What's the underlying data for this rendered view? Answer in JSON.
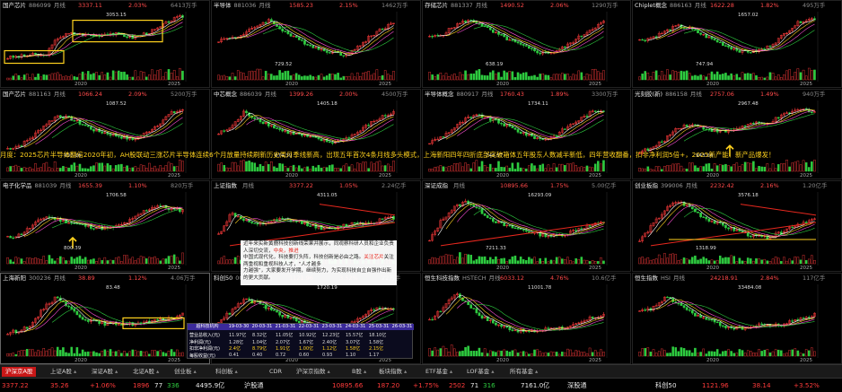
{
  "panels": [
    {
      "name": "国产芯片",
      "code": "886099",
      "period": "月线",
      "price": "3337.11",
      "change": "2.03%",
      "volume": "6413万手",
      "year1": "2020",
      "year2": "2025",
      "high": "3053.15",
      "low": "",
      "mark": ""
    },
    {
      "name": "半导体",
      "code": "881036",
      "period": "月线",
      "price": "1585.23",
      "change": "2.15%",
      "volume": "1462万手",
      "year1": "2020",
      "year2": "2025",
      "high": "",
      "low": "729.52",
      "mark": ""
    },
    {
      "name": "存储芯片",
      "code": "881337",
      "period": "月线",
      "price": "1490.52",
      "change": "2.06%",
      "volume": "1290万手",
      "year1": "2020",
      "year2": "2025",
      "high": "",
      "low": "638.19",
      "mark": ""
    },
    {
      "name": "Chiplet概念",
      "code": "886163",
      "period": "月线",
      "price": "1622.28",
      "change": "1.82%",
      "volume": "495万手",
      "year1": "2020",
      "year2": "2025",
      "high": "1657.02",
      "low": "747.94",
      "mark": ""
    },
    {
      "name": "国产芯片",
      "code": "881163",
      "period": "月线",
      "price": "1066.24",
      "change": "2.09%",
      "volume": "5200万手",
      "year1": "2020",
      "year2": "2025",
      "high": "1087.52",
      "low": "407.16",
      "mark": ""
    },
    {
      "name": "中芯概念",
      "code": "886039",
      "period": "月线",
      "price": "1399.26",
      "change": "2.00%",
      "volume": "4500万手",
      "year1": "2020",
      "year2": "2025",
      "high": "1405.18",
      "low": "674.39",
      "mark": ""
    },
    {
      "name": "半导体概念",
      "code": "880917",
      "period": "月线",
      "price": "1760.43",
      "change": "1.89%",
      "volume": "3300万手",
      "year1": "2020",
      "year2": "2025",
      "high": "1734.11",
      "low": "746.57",
      "mark": ""
    },
    {
      "name": "光刻胶(新)",
      "code": "886158",
      "period": "月线",
      "price": "2757.06",
      "change": "1.49%",
      "volume": "940万手",
      "year1": "2020",
      "year2": "2025",
      "high": "2967.48",
      "low": "943.64",
      "mark": ""
    },
    {
      "name": "电子化学品",
      "code": "881039",
      "period": "月线",
      "price": "1655.39",
      "change": "1.10%",
      "volume": "820万手",
      "year1": "2020",
      "year2": "2025",
      "high": "1706.58",
      "low": "800.39",
      "mark": ""
    },
    {
      "name": "上证指数",
      "code": "",
      "period": "月线",
      "price": "3377.22",
      "change": "1.05%",
      "volume": "2.24亿手",
      "year1": "2020",
      "year2": "2025",
      "high": "4311.05",
      "low": "2635.09",
      "mark": ""
    },
    {
      "name": "深证成指",
      "code": "",
      "period": "月线",
      "price": "10895.66",
      "change": "1.75%",
      "volume": "5.00亿手",
      "year1": "2020",
      "year2": "2025",
      "high": "16293.09",
      "low": "7211.33",
      "mark": ""
    },
    {
      "name": "创业板指",
      "code": "399006",
      "period": "月线",
      "price": "2232.42",
      "change": "2.16%",
      "volume": "1.20亿手",
      "year1": "2020",
      "year2": "2025",
      "high": "3576.18",
      "low": "1318.99",
      "mark": ""
    },
    {
      "name": "上海新阳",
      "code": "300236",
      "period": "月线",
      "price": "38.89",
      "change": "1.12%",
      "volume": "4.06万手",
      "year1": "2020",
      "year2": "2025",
      "high": "83.48",
      "low": "",
      "mark": ""
    },
    {
      "name": "科创50",
      "code": "000688",
      "period": "月线",
      "price": "1121.96",
      "change": "3.52%",
      "volume": "22万手",
      "year1": "2020",
      "year2": "2025",
      "high": "1720.19",
      "low": "",
      "mark": ""
    },
    {
      "name": "恒生科技指数",
      "code": "HSTECH",
      "period": "月线",
      "price": "6033.12",
      "change": "4.76%",
      "volume": "10.6亿手",
      "year1": "2020",
      "year2": "2025",
      "high": "11001.78",
      "low": "",
      "mark": ""
    },
    {
      "name": "恒生指数",
      "code": "HSI",
      "period": "月线",
      "price": "24218.91",
      "change": "2.84%",
      "volume": "117亿手",
      "year1": "2020",
      "year2": "2025",
      "high": "33484.08",
      "low": "",
      "mark": ""
    }
  ],
  "banner": "月度：2025芯片半导体翻倍2020年初，AH股联动三涨芯片半导体连续6个月放量持续刷新历史周月季线新高，出现五年首次4条月线多头模式，上海新阳四年四折底部突破箱体五年股东人数减半新低，四年营收翻番，扣非净利润5倍+，2025新产能、新产品爆发！",
  "note": {
    "l1": "近年来实新黄鹿科技创新线荣果并展示，同观察科研人员和企业负责人深切交流，",
    "l1b": "中央，推进",
    "l2a": "中国式现代化，科技要打头阵，科技创新是必由之路。",
    "l2b": "关注芯片",
    "l2c": "关注两重视和重视科技人才，“人才越多",
    "l3": "力越强”，大家要发开学期，继续努力，为实现科技自立自强作出新的更大贡献。"
  },
  "table": {
    "headers": [
      "超科技机构",
      "19-03-30",
      "20-03-31",
      "21-03-31",
      "22-03-31",
      "23-03-31",
      "24-03-31",
      "25-03-31",
      "26-03-31"
    ],
    "rows": [
      {
        "label": "营业总收入(元)",
        "vals": [
          "11.97亿",
          "8.32亿",
          "11.05亿",
          "10.92亿",
          "12.23亿",
          "15.57亿",
          "18.10亿"
        ]
      },
      {
        "label": "净利润(元)",
        "vals": [
          "1.28亿",
          "1.04亿",
          "2.07亿",
          "1.67亿",
          "2.40亿",
          "3.07亿",
          "1.58亿"
        ]
      },
      {
        "label": "扣非净利润(元)",
        "vals": [
          "2.4亿",
          "8.79亿",
          "1.91亿",
          "1.00亿",
          "1.12亿",
          "1.58亿",
          "2.15亿"
        ]
      },
      {
        "label": "每股收益(元)",
        "vals": [
          "0.41",
          "0.40",
          "0.72",
          "0.60",
          "0.93",
          "1.10",
          "1.17"
        ]
      }
    ]
  },
  "tabs": [
    {
      "label": "沪深京A股",
      "active": true
    },
    {
      "label": "上证A股",
      "active": false
    },
    {
      "label": "深证A股",
      "active": false
    },
    {
      "label": "北证A股",
      "active": false
    },
    {
      "label": "创业板",
      "active": false
    },
    {
      "label": "科创板",
      "active": false
    },
    {
      "label": "CDR",
      "active": false
    },
    {
      "label": "沪深京指数",
      "active": false
    },
    {
      "label": "B股",
      "active": false
    },
    {
      "label": "板块指数",
      "active": false
    },
    {
      "label": "ETF基金",
      "active": false
    },
    {
      "label": "LOF基金",
      "active": false
    },
    {
      "label": "所有基金",
      "active": false
    }
  ],
  "status": {
    "s1": "3377.22",
    "s2": "35.26",
    "s3": "+1.06%",
    "s4": "1896",
    "s5": "77",
    "s6": "336",
    "s7": "4495.9亿",
    "s8": "沪股通",
    "s9": "10895.66",
    "s10": "187.20",
    "s11": "+1.75%",
    "s12": "2502",
    "s13": "71",
    "s14": "316",
    "s15": "7161.0亿",
    "s16": "深股通",
    "s17": "科创50",
    "s18": "1121.96",
    "s19": "38.14",
    "s20": "+3.52%"
  },
  "colors": {
    "up": "#ff3b3b",
    "down": "#2ecc40",
    "accent": "#ffd21e",
    "tab_active": "#c81818"
  }
}
